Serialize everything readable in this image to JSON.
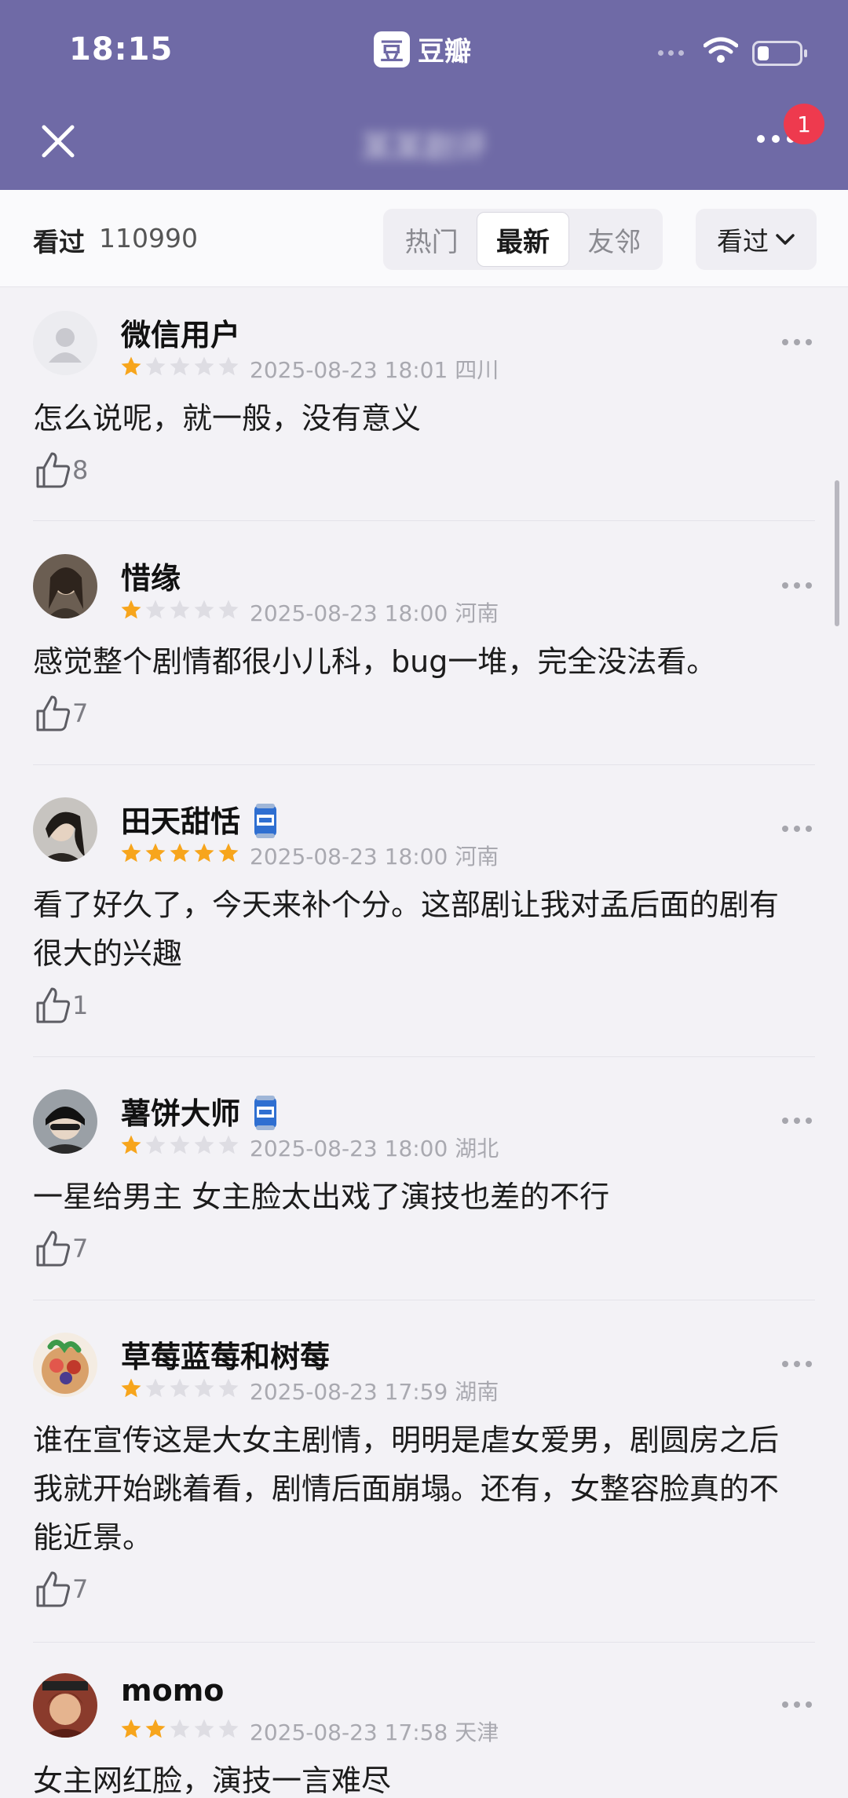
{
  "status_bar": {
    "time": "18:15",
    "app_logo_glyph": "豆",
    "app_name": "豆瓣"
  },
  "header": {
    "title": "某某剧评",
    "notification_count": "1",
    "icons": [
      "close-icon",
      "more-icon"
    ]
  },
  "filter_bar": {
    "seen_label": "看过",
    "seen_count": "110990",
    "tabs": [
      {
        "label": "热门",
        "active": false
      },
      {
        "label": "最新",
        "active": true
      },
      {
        "label": "友邻",
        "active": false
      }
    ],
    "sort_label": "看过"
  },
  "colors": {
    "header_bg": "#6f6aa6",
    "star_on": "#f7a51c",
    "star_off": "#dedde3",
    "badge": "#ee3a4e"
  },
  "reviews": [
    {
      "user": "微信用户",
      "stars": 1,
      "date": "2025-08-23 18:01",
      "location": "四川",
      "text": "怎么说呢，就一般，没有意义",
      "likes": "8",
      "has_badge": false
    },
    {
      "user": "惜缘",
      "stars": 1,
      "date": "2025-08-23 18:00",
      "location": "河南",
      "text": "感觉整个剧情都很小儿科，bug一堆，完全没法看。",
      "likes": "7",
      "has_badge": false
    },
    {
      "user": "田天甜恬",
      "stars": 5,
      "date": "2025-08-23 18:00",
      "location": "河南",
      "text": "看了好久了，今天来补个分。这部剧让我对孟后面的剧有很大的兴趣",
      "likes": "1",
      "has_badge": true
    },
    {
      "user": "薯饼大师",
      "stars": 1,
      "date": "2025-08-23 18:00",
      "location": "湖北",
      "text": "一星给男主  女主脸太出戏了演技也差的不行",
      "likes": "7",
      "has_badge": true
    },
    {
      "user": "草莓蓝莓和树莓",
      "stars": 1,
      "date": "2025-08-23 17:59",
      "location": "湖南",
      "text": "谁在宣传这是大女主剧情，明明是虐女爱男，剧圆房之后我就开始跳着看，剧情后面崩塌。还有，女整容脸真的不能近景。",
      "likes": "7",
      "has_badge": false
    },
    {
      "user": "momo",
      "stars": 2,
      "date": "2025-08-23 17:58",
      "location": "天津",
      "text": "女主网红脸，演技一言难尽",
      "likes": "",
      "has_badge": false
    }
  ]
}
